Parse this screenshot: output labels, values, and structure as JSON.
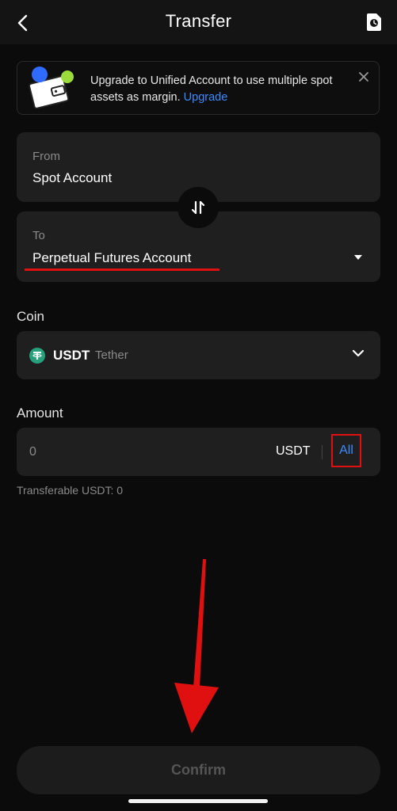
{
  "header": {
    "title": "Transfer",
    "back_icon": "chevron-left-icon",
    "history_icon": "history-clock-icon"
  },
  "banner": {
    "text": "Upgrade to Unified Account to use multiple spot assets as margin.",
    "link": "Upgrade",
    "close_icon": "close-icon"
  },
  "from": {
    "label": "From",
    "value": "Spot Account"
  },
  "to": {
    "label": "To",
    "value": "Perpetual Futures Account"
  },
  "coin": {
    "section_label": "Coin",
    "symbol": "USDT",
    "name": "Tether"
  },
  "amount": {
    "section_label": "Amount",
    "placeholder": "0",
    "unit": "USDT",
    "all_label": "All",
    "transferable": "Transferable USDT: 0"
  },
  "confirm_label": "Confirm",
  "colors": {
    "accent": "#3d8bff",
    "highlight": "#e01010",
    "card": "#1f1f1f",
    "background": "#0b0b0b",
    "tether": "#26a17b"
  }
}
